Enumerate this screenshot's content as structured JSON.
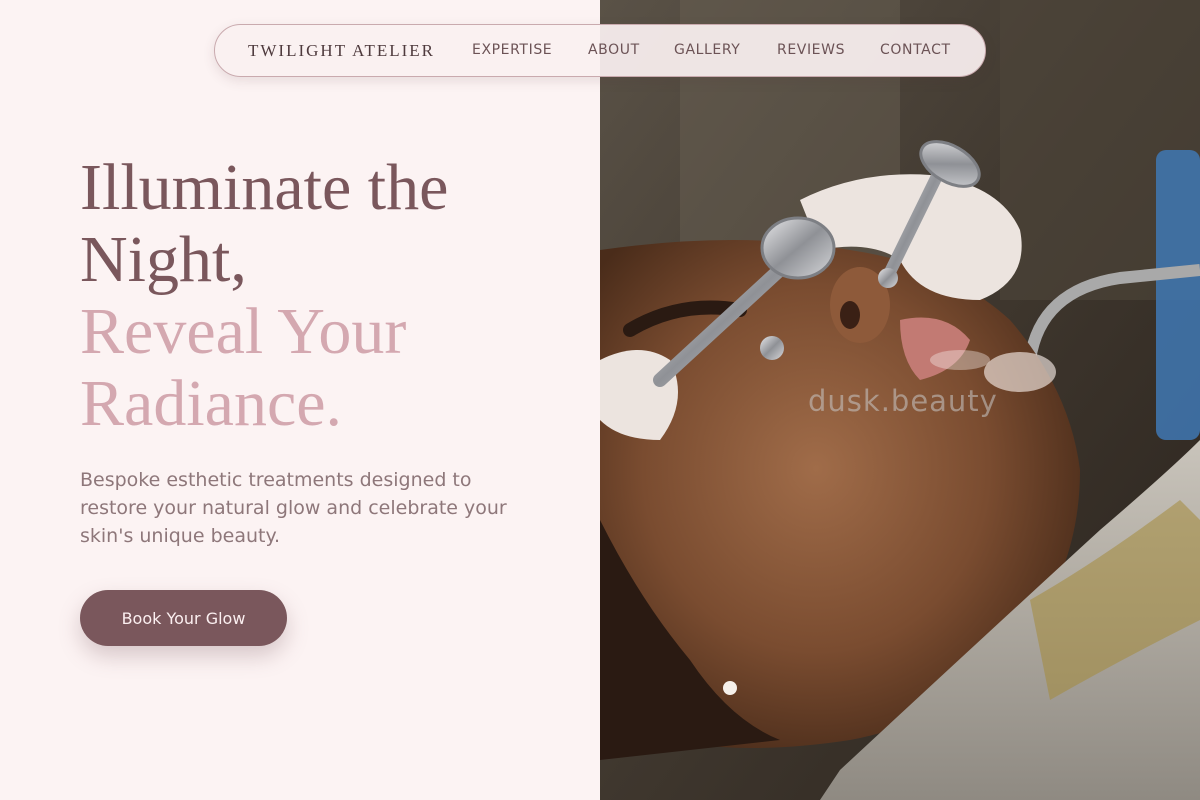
{
  "nav": {
    "brand": "TWILIGHT ATELIER",
    "links": [
      "EXPERTISE",
      "ABOUT",
      "GALLERY",
      "REVIEWS",
      "CONTACT"
    ]
  },
  "hero": {
    "headline_dark": [
      "Illuminate the",
      "Night,"
    ],
    "headline_light": [
      "Reveal Your",
      "Radiance."
    ],
    "subtext": "Bespoke esthetic treatments designed to restore your natural glow and celebrate your skin's unique beauty.",
    "cta_label": "Book Your Glow"
  },
  "image": {
    "watermark": "dusk.beauty"
  },
  "colors": {
    "background": "#fcf3f3",
    "accent_dark": "#7a575c",
    "accent_light": "#d4a8b0",
    "body_text": "#8e777a"
  }
}
